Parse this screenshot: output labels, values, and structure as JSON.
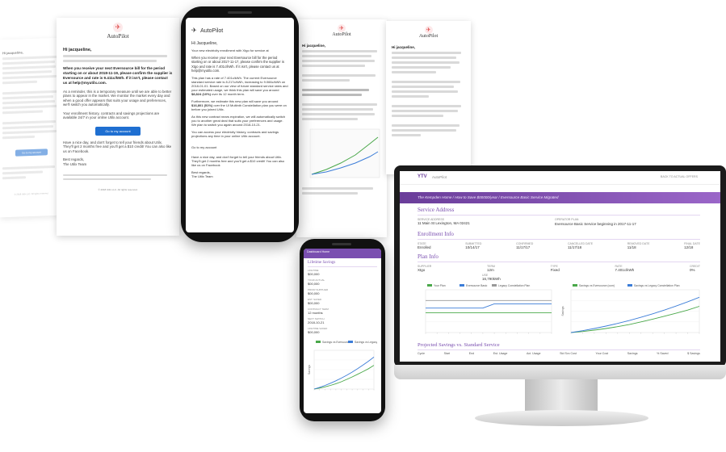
{
  "brand": {
    "name": "AutoPilot",
    "accent": "#7a4fb0",
    "button": "#1f6fd1"
  },
  "email": {
    "greeting": "Hi Jacqueline,",
    "greeting_alt": "Hi jacqueline,",
    "center_p1": "Your new electricity enrollment with Xtgo for service at",
    "center_bold": "When you receive your next Eversource bill for the period starting on or about 2017-11-17, please confirm the supplier is Xtgo and rate is 7.401c/kWh. If it isn't, please contact us at help@myutilx.com.",
    "center_p2": "This plan has a rate of 7.401c/kWh. The current Eversource standard service rate is 8.217c/kWh, increasing to 9.066c/kWh on 2018-01-01. Based on our view of future standard service rates and your estimated usage, we think this plan will save you around",
    "center_savings": "$8,824 (10%)",
    "center_p2b": "over its 12 month term.",
    "center_p3": "Furthermore, we estimate this new plan will save you around",
    "center_savings2": "$16,801 (51%)",
    "center_p3b": "over the UI Multinth Constellation plan you were on before you joined Utilx.",
    "center_p4": "As this new contract nears expiration, we will automatically switch you to another great deal that suits your preferences and usage. We plan to switch you again around 2018-10-21.",
    "center_p5": "You can access your electricity history, contracts and savings projections any time in your online Utilx account.",
    "button": "Go to my account",
    "ps": "Have a nice day, and don't forget to",
    "ps_link": "tell your friends",
    "ps_b": "about Utilx. They'll get 2 months free and you'll get a $10 credit! You can also",
    "ps_link2": "like us on Facebook",
    "signoff": "Best regards,",
    "team": "The Utilx Team",
    "left_bold": "When you receive your next Eversource bill for the period starting on or about 2018-11-19, please confirm the supplier is Eversource and rate is 9.411c/kWh. If it isn't, please contact us at help@myutilx.com.",
    "left_p2": "As a reminder, this is a temporary measure until we are able to better plans to appear in the market. We monitor the market every day and when a good offer appears that suits your usage and preferences, we'll switch you automatically.",
    "left_p3": "Your enrollment history, contracts and savings projections are available 24/7 in your online Utilx account.",
    "left_ps": "Have a nice day, and don't forget to tell your friends about Utilx. They'll get 2 months free and you'll get a $10 credit! You can also like us on Facebook.",
    "copyright": "© 2018 Utilx LLC. All rights reserved.",
    "address": "Utilx\n63 Memorial Way, 2nd Floor\nBoston, MA 02116",
    "site": "https://www.myutilx.com"
  },
  "dashboard": {
    "logo": "YTV",
    "app": "AutoPilot",
    "top_right": "BACK TO ACTUAL OFFERS",
    "banner": "The Kempden Home / How to Save $00000/year / Eversource Basic Service Migrated",
    "service_address_title": "Service Address",
    "service_address_label": "SERVICE ADDRESS",
    "service_address_value": "11 Main St Lexington, MA 02421",
    "operator_label": "OPERATOR PLAN",
    "operator_value": "Eversource Basic Service beginning in 2017-11-17",
    "enrollment_title": "Enrollment Info",
    "enrollment_cols": [
      "STATE",
      "SUBMITTED",
      "CONFIRMED",
      "CANCELLED DATE",
      "REMOVED DATE",
      "FINAL DATE"
    ],
    "enrollment_vals": [
      "Enrolled",
      "10/14/17",
      "11/17/17",
      "11/17/18",
      "11/18",
      "12/18"
    ],
    "plan_title": "Plan Info",
    "plan_cols": [
      "SUPPLIER",
      "TERM",
      "TYPE",
      "RATE",
      "CREDIT"
    ],
    "plan_vals": [
      "Xtgo",
      "12m",
      "Fixed",
      "7.401c/kWh",
      "0%"
    ],
    "plan_usage_label": "USE",
    "plan_usage": "16,790kWh",
    "projected_title": "Projected Savings vs. Standard Service",
    "table_cols": [
      "Cycle",
      "Start",
      "End",
      "Est. Usage",
      "Act. Usage",
      "Std Svc Cost",
      "Your Cost",
      "Savings",
      "% Saved",
      "$ Savings"
    ],
    "chart1_legend": [
      "Your Plan",
      "Eversource Basic",
      "Legacy Constellation Plan"
    ],
    "chart2_legend": [
      "Savings vs Eversource (cum)",
      "Savings vs Legacy Constellation Plan"
    ],
    "chart2_ylabel": "Savings"
  },
  "mobile": {
    "header": "Dashboard Home",
    "section": "Lifetime Savings",
    "rows": [
      {
        "label": "LIFETIME",
        "value": "$00,000"
      },
      {
        "label": "YOUR ACTUAL",
        "value": "$00,000"
      },
      {
        "label": "PRIOR SUPPLIER",
        "value": "$00,000"
      },
      {
        "label": "EST. SAVED",
        "value": "$00,000"
      },
      {
        "label": "CONTRACT TERM",
        "value": "12 months"
      },
      {
        "label": "NEXT SWITCH",
        "value": "2018-10-21"
      },
      {
        "label": "LIFETIME SAVED",
        "value": "$00,000"
      }
    ],
    "chart_legend": [
      "Savings vs Eversource",
      "Savings vs Legacy Constellation Plan"
    ]
  },
  "chart_data": [
    {
      "type": "line",
      "series": [
        {
          "name": "Your Plan",
          "values": [
            6.5,
            6.5,
            6.5,
            6.5,
            6.5,
            6.5,
            6.5,
            6.5,
            6.5,
            6.5,
            6.5,
            6.5
          ]
        },
        {
          "name": "Eversource Basic",
          "values": [
            8.0,
            8.0,
            8.0,
            8.0,
            8.0,
            8.0,
            9.4,
            9.4,
            9.4,
            9.4,
            9.4,
            9.4
          ]
        },
        {
          "name": "Legacy Constellation Plan",
          "values": [
            10.5,
            10.5,
            10.5,
            10.5,
            10.5,
            10.5,
            10.5,
            10.5,
            10.5,
            10.5,
            10.5,
            10.5
          ]
        }
      ],
      "ylim": [
        0,
        14
      ]
    },
    {
      "type": "line",
      "series": [
        {
          "name": "Savings vs Eversource (cum)",
          "values": [
            0,
            20,
            45,
            75,
            110,
            150,
            200,
            250,
            305,
            360,
            420,
            490
          ]
        },
        {
          "name": "Savings vs Legacy Constellation Plan",
          "values": [
            0,
            35,
            75,
            120,
            170,
            225,
            285,
            350,
            420,
            495,
            575,
            660
          ]
        }
      ],
      "ylabel": "Savings",
      "ylim": [
        0,
        800
      ]
    }
  ],
  "colors": {
    "green": "#4aa84a",
    "blue": "#3c7dd8",
    "gray": "#999999",
    "purple": "#7a4fb0"
  }
}
